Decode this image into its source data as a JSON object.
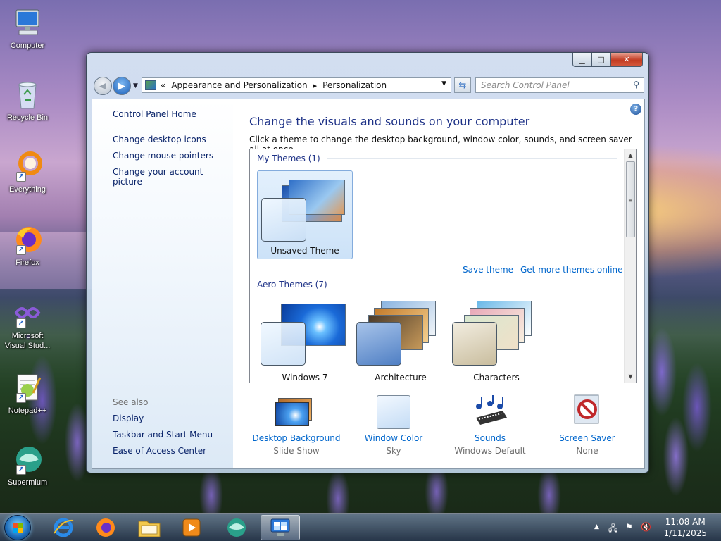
{
  "desktop": {
    "icons": [
      {
        "label": "Computer"
      },
      {
        "label": "Recycle Bin"
      },
      {
        "label": "Everything"
      },
      {
        "label": "Firefox"
      },
      {
        "label": "Microsoft Visual Stud..."
      },
      {
        "label": "Notepad++"
      },
      {
        "label": "Supermium"
      }
    ]
  },
  "window": {
    "caption_buttons": {
      "minimize": "▁",
      "maximize": "□",
      "close": "✕"
    },
    "address": {
      "prefix": "«",
      "crumbs": [
        "Appearance and Personalization",
        "Personalization"
      ],
      "separator": "▸"
    },
    "search_placeholder": "Search Control Panel",
    "left_pane": {
      "home": "Control Panel Home",
      "tasks": [
        "Change desktop icons",
        "Change mouse pointers",
        "Change your account picture"
      ],
      "see_also_title": "See also",
      "see_also": [
        "Display",
        "Taskbar and Start Menu",
        "Ease of Access Center"
      ]
    },
    "main": {
      "heading": "Change the visuals and sounds on your computer",
      "subtitle": "Click a theme to change the desktop background, window color, sounds, and screen saver all at once.",
      "my_themes_header": "My Themes (1)",
      "my_themes": [
        {
          "name": "Unsaved Theme",
          "selected": true
        }
      ],
      "save_theme": "Save theme",
      "get_more": "Get more themes online",
      "aero_header": "Aero Themes (7)",
      "aero_themes": [
        {
          "name": "Windows 7"
        },
        {
          "name": "Architecture"
        },
        {
          "name": "Characters"
        }
      ],
      "bottom_items": [
        {
          "label": "Desktop Background",
          "value": "Slide Show"
        },
        {
          "label": "Window Color",
          "value": "Sky"
        },
        {
          "label": "Sounds",
          "value": "Windows Default"
        },
        {
          "label": "Screen Saver",
          "value": "None"
        }
      ]
    }
  },
  "taskbar": {
    "apps": [
      "internet-explorer",
      "firefox",
      "file-explorer",
      "media-player",
      "supermium",
      "control-panel"
    ],
    "active_app": "control-panel",
    "clock": {
      "time": "11:08 AM",
      "date": "1/11/2025"
    }
  },
  "colors": {
    "link": "#0066cc",
    "heading": "#1e3287",
    "close_button": "#c23c22",
    "selection": "#cce2f8"
  }
}
